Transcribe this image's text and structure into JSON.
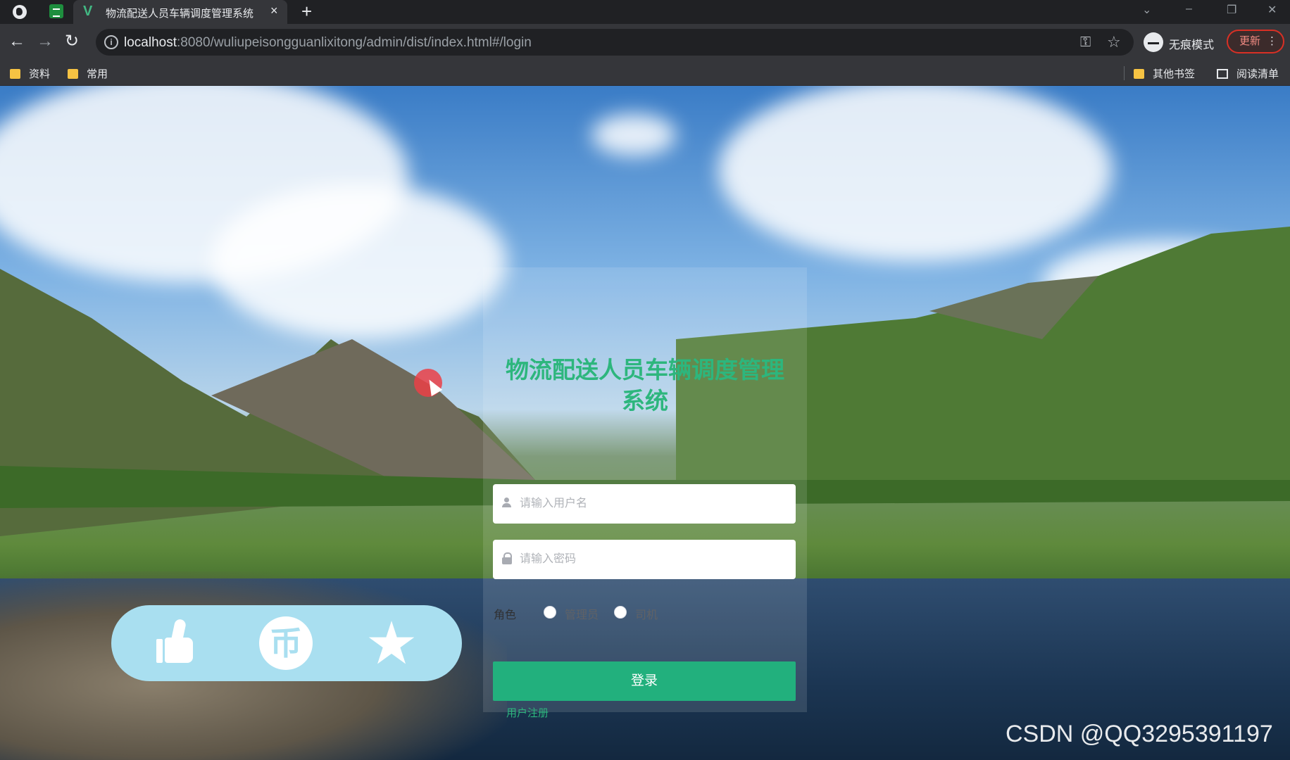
{
  "browser": {
    "tab_title": "物流配送人员车辆调度管理系统",
    "tab_close": "×",
    "new_tab": "+",
    "url_host": "localhost",
    "url_rest": ":8080/wuliupeisongguanlixitong/admin/dist/index.html#/login",
    "incognito_label": "无痕模式",
    "update_label": "更新",
    "bookmarks": [
      "资料",
      "常用"
    ],
    "other_bookmarks": "其他书签",
    "reading_list": "阅读清单"
  },
  "login": {
    "title": "物流配送人员车辆调度管理系统",
    "username_placeholder": "请输入用户名",
    "password_placeholder": "请输入密码",
    "role_label": "角色",
    "roles": [
      "管理员",
      "司机"
    ],
    "submit_label": "登录",
    "register_link": "用户注册"
  },
  "overlay": {
    "icons": [
      "thumbs-up-icon",
      "coin-icon",
      "star-icon"
    ],
    "coin_glyph": "币"
  },
  "watermark": "CSDN @QQ3295391197",
  "colors": {
    "accent_green": "#22b07d",
    "title_green": "#2db67d",
    "overlay_bar": "#a9dff0",
    "update_red": "#d93025"
  }
}
